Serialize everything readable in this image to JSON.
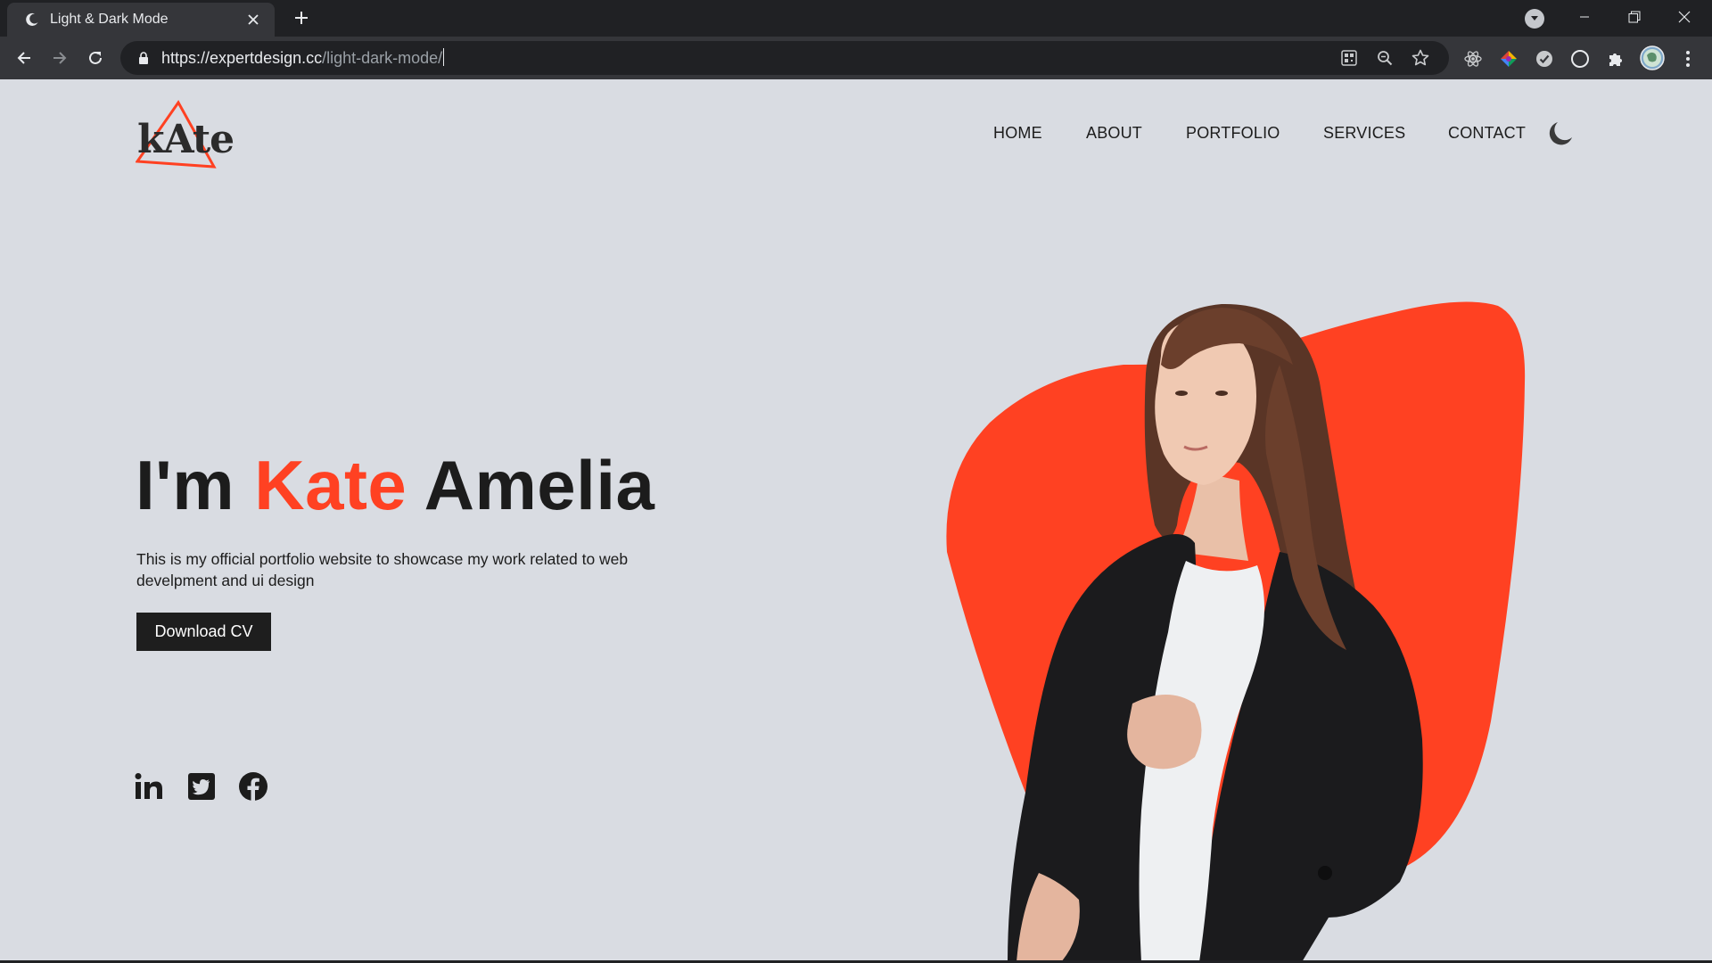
{
  "browser": {
    "tab_title": "Light & Dark Mode",
    "url_host": "https://expertdesign.cc",
    "url_path": "/light-dark-mode/"
  },
  "colors": {
    "accent": "#ff4122",
    "page_background": "#d9dce2",
    "text": "#1c1c1c",
    "button_background": "#1e1e1e"
  },
  "site": {
    "logo_text": "kAte",
    "nav": {
      "items": [
        {
          "label": "HOME"
        },
        {
          "label": "ABOUT"
        },
        {
          "label": "PORTFOLIO"
        },
        {
          "label": "SERVICES"
        },
        {
          "label": "CONTACT"
        }
      ],
      "theme_toggle_icon": "moon-icon"
    },
    "hero": {
      "greeting": "I'm",
      "first_name": "Kate",
      "last_name": "Amelia",
      "description": "This is my official portfolio website to showcase my work related to web develpment and ui design",
      "cta_label": "Download CV"
    },
    "social_icons": [
      "linkedin-icon",
      "twitter-icon",
      "facebook-icon"
    ]
  }
}
